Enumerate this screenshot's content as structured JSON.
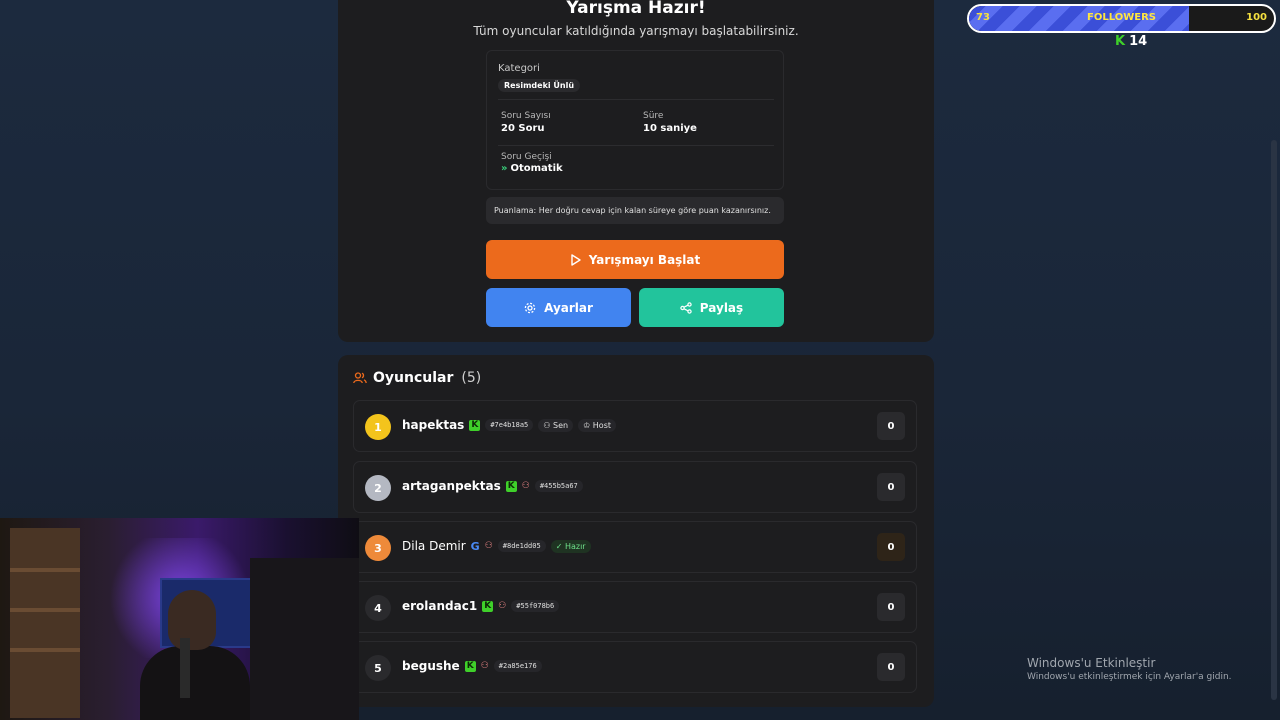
{
  "setup": {
    "title": "Yarışma Hazır!",
    "subtitle": "Tüm oyuncular katıldığında yarışmayı başlatabilirsiniz.",
    "category_label": "Kategori",
    "category_value": "Resimdeki Ünlü",
    "question_count_label": "Soru Sayısı",
    "question_count_value": "20 Soru",
    "duration_label": "Süre",
    "duration_value": "10 saniye",
    "transition_label": "Soru Geçişi",
    "transition_value": "Otomatik",
    "scoring_note": "Puanlama: Her doğru cevap için kalan süreye göre puan kazanırsınız.",
    "start_button": "Yarışmayı Başlat",
    "settings_button": "Ayarlar",
    "share_button": "Paylaş"
  },
  "players": {
    "title": "Oyuncular",
    "count": "(5)",
    "list": [
      {
        "rank": "1",
        "name": "hapektas",
        "platform": "kick",
        "id": "#7e4b18a5",
        "tags": [
          "Sen",
          "Host"
        ],
        "score": "0",
        "rank_color": "#f3c41c"
      },
      {
        "rank": "2",
        "name": "artaganpektas",
        "platform": "kick",
        "id": "#455b5a67",
        "score": "0",
        "rank_color": "#b4b8c2"
      },
      {
        "rank": "3",
        "name": "Dila Demir",
        "platform": "google",
        "id": "#8de1dd05",
        "ready": "Hazır",
        "score": "0",
        "rank_color": "#ee8a3a"
      },
      {
        "rank": "4",
        "name": "erolandac1",
        "platform": "kick",
        "id": "#55f078b6",
        "score": "0",
        "rank_color": "#2a2a2d"
      },
      {
        "rank": "5",
        "name": "begushe",
        "platform": "kick",
        "id": "#2a85e176",
        "score": "0",
        "rank_color": "#2a2a2d"
      }
    ]
  },
  "overlay": {
    "followers_label": "FOLLOWERS",
    "followers_current": "73",
    "followers_goal": "100",
    "kick_count": "14"
  },
  "windows": {
    "activate_title": "Windows'u Etkinleştir",
    "activate_sub": "Windows'u etkinleştirmek için Ayarlar'a gidin."
  },
  "colors": {
    "start": "#ec6a1c",
    "settings": "#4184f0",
    "share": "#22c49c",
    "kick": "#3fd02a"
  }
}
